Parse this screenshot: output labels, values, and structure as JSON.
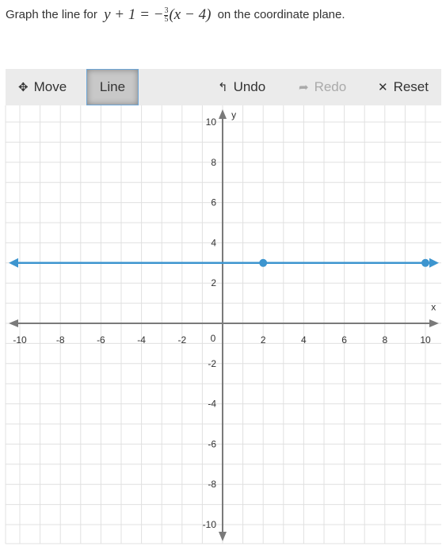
{
  "prompt": {
    "prefix": "Graph the line for",
    "equation": {
      "lhs": "y + 1 = −",
      "frac_num": "3",
      "frac_den": "5",
      "rhs": "(x − 4)"
    },
    "suffix": "on the coordinate plane."
  },
  "toolbar": {
    "move": {
      "label": "Move",
      "icon": "move-arrows-icon"
    },
    "line": {
      "label": "Line",
      "active": true
    },
    "undo": {
      "label": "Undo",
      "icon": "undo-arrow-icon"
    },
    "redo": {
      "label": "Redo",
      "icon": "redo-arrow-icon",
      "disabled": true
    },
    "reset": {
      "label": "Reset",
      "icon": "close-x-icon"
    }
  },
  "colors": {
    "line": "#3d95cf",
    "axis": "#7a7a7a",
    "grid": "#e0e0e0",
    "toolbar": "#ebebeb"
  },
  "chart_data": {
    "type": "line",
    "x_range": [
      -10,
      10
    ],
    "y_range": [
      -10,
      10
    ],
    "grid": true,
    "xlabel": "x",
    "ylabel": "y",
    "x_ticks": [
      "-10",
      "-8",
      "-6",
      "-4",
      "-2",
      "2",
      "4",
      "6",
      "8",
      "10"
    ],
    "y_ticks": [
      "10",
      "8",
      "6",
      "4",
      "2",
      "-2",
      "-4",
      "-6",
      "-8",
      "-10"
    ],
    "origin_label": "0",
    "plotted_line": {
      "points": [
        [
          2,
          3
        ],
        [
          10,
          3
        ]
      ],
      "extends_both_ways": true
    }
  }
}
